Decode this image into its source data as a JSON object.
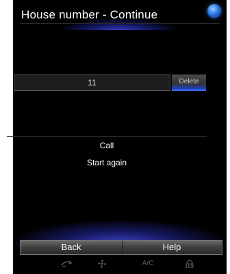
{
  "header": {
    "title": "House number - Continue"
  },
  "entry": {
    "value": "11",
    "delete_label": "Delete"
  },
  "menu": {
    "call": "Call",
    "start_again": "Start again"
  },
  "footer": {
    "back": "Back",
    "help": "Help"
  },
  "status_bar": {
    "icons": [
      "recirculation-icon",
      "fan-icon",
      "ac-icon",
      "defrost-icon"
    ],
    "ac_label": "A/C"
  },
  "colors": {
    "accent": "#2f5cff",
    "background": "#000000"
  }
}
